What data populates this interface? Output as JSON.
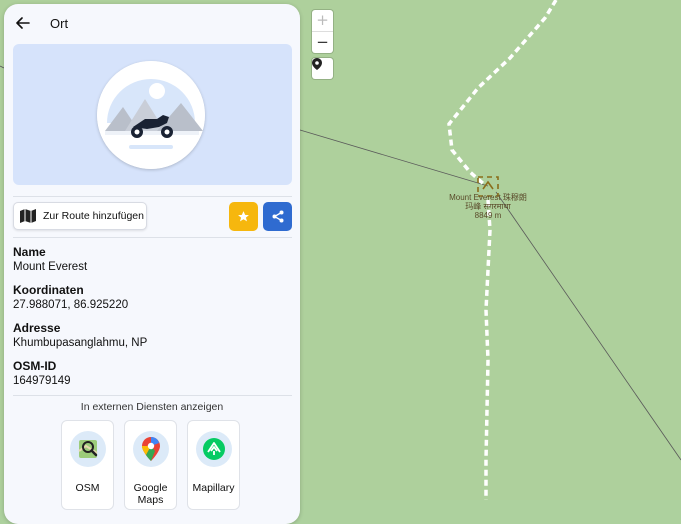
{
  "panel": {
    "title": "Ort",
    "route_button_label": "Zur Route hinzufügen",
    "fields": [
      {
        "label": "Name",
        "value": "Mount Everest"
      },
      {
        "label": "Koordinaten",
        "value": "27.988071, 86.925220"
      },
      {
        "label": "Adresse",
        "value": "Khumbupasanglahmu, NP"
      },
      {
        "label": "OSM-ID",
        "value": "164979149"
      }
    ],
    "external_title": "In externen Diensten anzeigen",
    "services": [
      {
        "name": "OSM",
        "icon": "osm-map-icon"
      },
      {
        "name": "Google Maps",
        "icon": "google-maps-pin-icon"
      },
      {
        "name": "Mapillary",
        "icon": "mapillary-icon"
      }
    ]
  },
  "map": {
    "zoom_in": "+",
    "zoom_out": "−",
    "peak_label_line1": "Mount Everest 珠穆朗",
    "peak_label_line2": "玛峰 सगरमाथा",
    "peak_label_line3": "8849 m"
  },
  "colors": {
    "map_background": "#aed09c",
    "star_button": "#f6b70e",
    "share_button": "#2f6bd0",
    "panel_background": "#f6f8fd"
  }
}
